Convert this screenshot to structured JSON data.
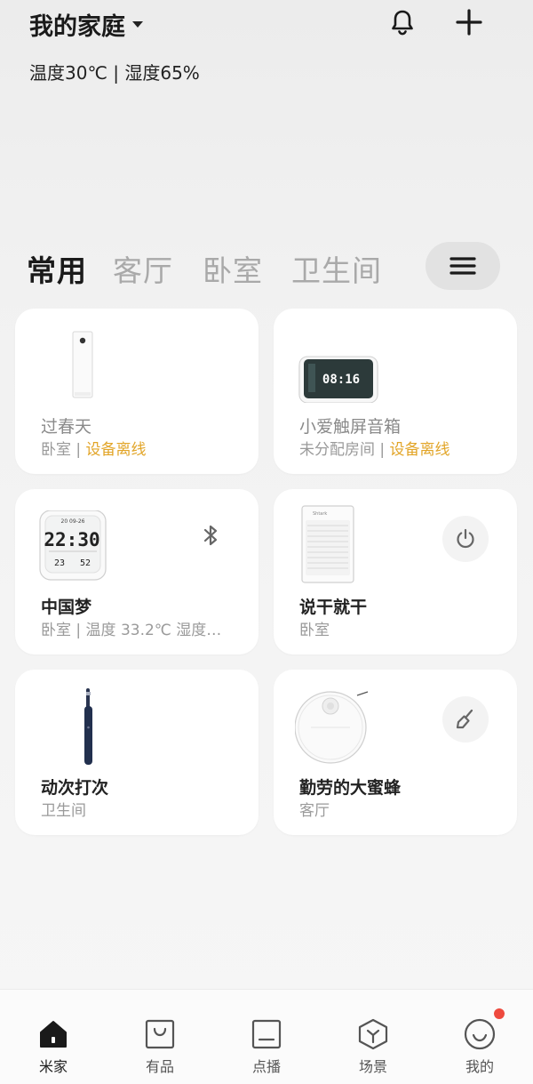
{
  "header": {
    "home_name": "我的家庭",
    "weather": "温度30℃ | 湿度65%"
  },
  "tabs": [
    {
      "label": "常用",
      "active": true
    },
    {
      "label": "客厅",
      "active": false
    },
    {
      "label": "卧室",
      "active": false
    },
    {
      "label": "卫生间",
      "active": false
    }
  ],
  "devices": [
    {
      "name": "过春天",
      "room": "卧室 | ",
      "status": "设备离线",
      "offline": true,
      "icon": "air-purifier-icon"
    },
    {
      "name": "小爱触屏音箱",
      "room": "未分配房间 | ",
      "status": "设备离线",
      "offline": true,
      "icon": "smart-speaker-icon",
      "clock": "08:16"
    },
    {
      "name": "中国梦",
      "room": "卧室 | 温度 33.2℃ 湿度…",
      "status": "",
      "offline": false,
      "icon": "thermo-clock-icon",
      "action": "bluetooth-icon",
      "clock": "22:30",
      "small_a": "23",
      "small_b": "52",
      "date": "20 09-26"
    },
    {
      "name": "说干就干",
      "room": "卧室",
      "status": "",
      "offline": false,
      "icon": "air-purifier-icon",
      "action": "power-icon"
    },
    {
      "name": "动次打次",
      "room": "卫生间",
      "status": "",
      "offline": false,
      "icon": "toothbrush-icon"
    },
    {
      "name": "勤劳的大蜜蜂",
      "room": "客厅",
      "status": "",
      "offline": false,
      "icon": "robot-vacuum-icon",
      "action": "broom-icon"
    }
  ],
  "nav": [
    {
      "label": "米家",
      "icon": "home-icon",
      "active": true
    },
    {
      "label": "有品",
      "icon": "shopping-bag-icon",
      "active": false
    },
    {
      "label": "点播",
      "icon": "tv-icon",
      "active": false
    },
    {
      "label": "场景",
      "icon": "cube-icon",
      "active": false
    },
    {
      "label": "我的",
      "icon": "smiley-icon",
      "active": false,
      "badge": true
    }
  ],
  "colors": {
    "warn": "#e2a528",
    "badge": "#ee4a3e",
    "active_text": "#1a1a1a",
    "inactive_tab": "#a9a9a9"
  }
}
